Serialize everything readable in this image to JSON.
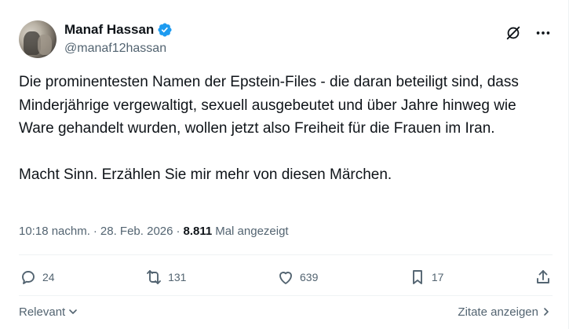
{
  "author": {
    "display_name": "Manaf Hassan",
    "handle": "@manaf12hassan",
    "verified_badge_color": "#1d9bf0"
  },
  "tweet": {
    "paragraphs": [
      "Die prominentesten Namen der Epstein-Files - die daran beteiligt sind, dass Minderjährige vergewaltigt, sexuell ausgebeutet und über Jahre hinweg wie Ware gehandelt wurden, wollen jetzt also Freiheit für die Frauen im Iran.",
      "Macht Sinn. Erzählen Sie mir mehr von diesen Märchen."
    ]
  },
  "meta": {
    "time": "10:18 nachm.",
    "separator": "·",
    "date": "28. Feb. 2026",
    "separator2": "·",
    "views_count": "8.811",
    "views_label": "Mal angezeigt"
  },
  "actions": {
    "replies": "24",
    "reposts": "131",
    "likes": "639",
    "bookmarks": "17"
  },
  "footer": {
    "sort_label": "Relevant",
    "quotes_label": "Zitate anzeigen"
  },
  "icons": {
    "top": [
      "grok-icon",
      "more-icon"
    ],
    "actions": [
      "reply-icon",
      "repost-icon",
      "like-icon",
      "bookmark-icon",
      "share-icon"
    ]
  },
  "colors": {
    "text_primary": "#0f1419",
    "text_secondary": "#536471",
    "divider": "#eff3f4",
    "accent": "#1d9bf0"
  }
}
